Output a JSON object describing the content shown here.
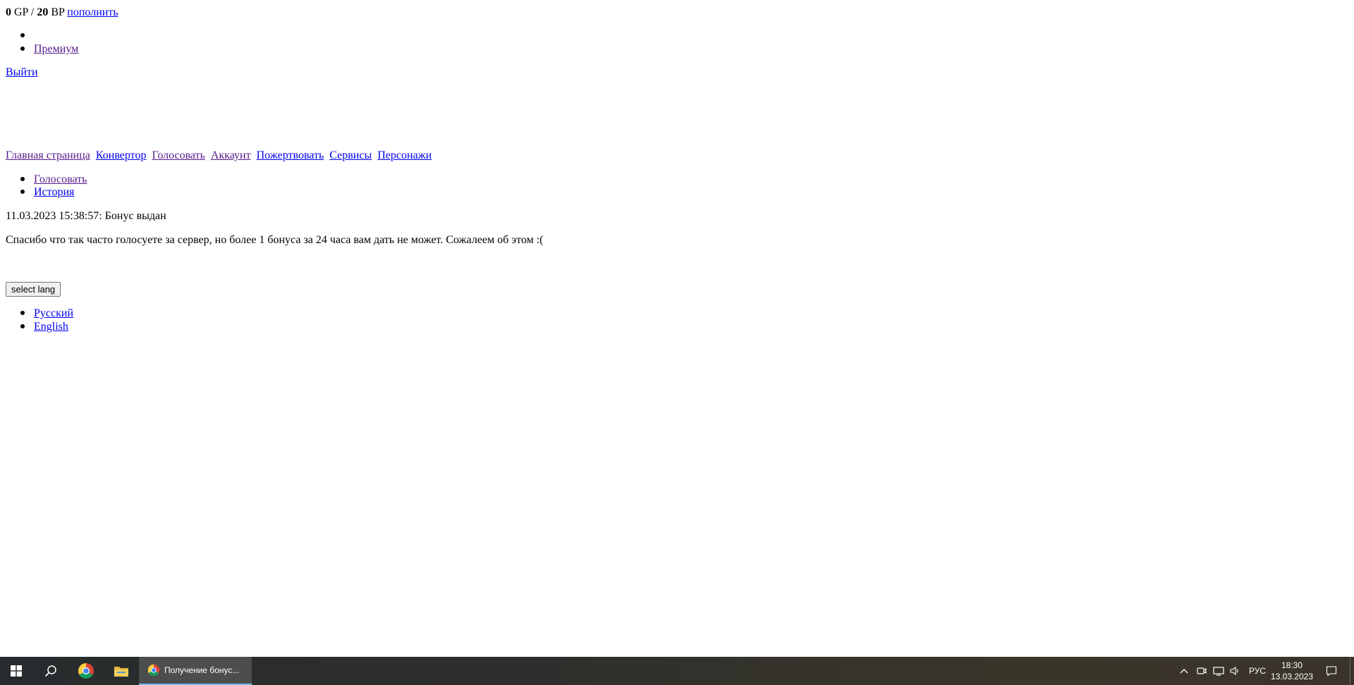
{
  "balance": {
    "gp_value": "0",
    "gp_unit": "GP",
    "separator": "/",
    "bp_value": "20",
    "bp_unit": "BP",
    "topup_link": "пополнить"
  },
  "user_menu": {
    "items": [
      {
        "label": ""
      },
      {
        "label": "Премиум"
      }
    ]
  },
  "logout_link": "Выйти",
  "main_nav": [
    {
      "label": "Главная страница"
    },
    {
      "label": "Конвертор"
    },
    {
      "label": "Голосовать"
    },
    {
      "label": "Аккаунт"
    },
    {
      "label": "Пожертвовать"
    },
    {
      "label": "Сервисы"
    },
    {
      "label": "Персонажи"
    }
  ],
  "sub_nav": [
    {
      "label": "Голосовать"
    },
    {
      "label": "История"
    }
  ],
  "bonus_status": "11.03.2023 15:38:57: Бонус выдан",
  "message": "Спасибо что так часто голосуете за сервер, но более 1 бонуса за 24 часа вам дать не может. Сожалеем об этом :(",
  "lang_button": "select lang",
  "languages": [
    {
      "label": "Русский"
    },
    {
      "label": "English"
    }
  ],
  "taskbar": {
    "active_window_title": "Получение бонус...",
    "language": "РУС",
    "time": "18:30",
    "date": "13.03.2023",
    "pinned_icons": [
      "windows-start-icon",
      "search-icon",
      "chrome-icon",
      "file-explorer-icon"
    ],
    "tray_icons": [
      "chevron-up-icon",
      "meet-now-icon",
      "network-icon",
      "volume-icon",
      "notification-icon"
    ]
  }
}
